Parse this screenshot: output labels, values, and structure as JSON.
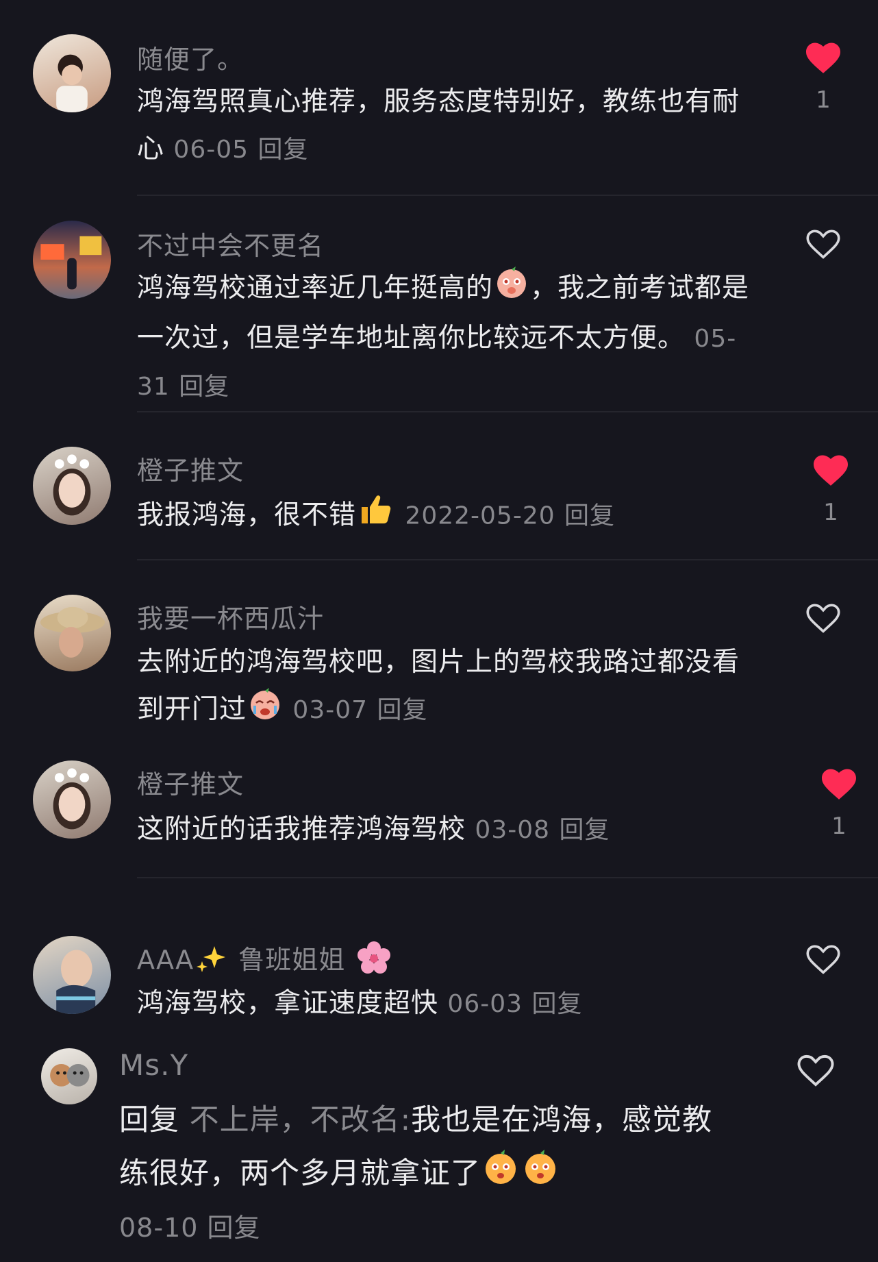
{
  "comments": [
    {
      "username": "随便了。",
      "text": "鸿海驾照真心推荐，服务态度特别好，教练也有耐心",
      "date": "06-05",
      "reply": "回复",
      "liked": true,
      "likes": "1"
    },
    {
      "username": "不过中会不更名",
      "text_a": "鸿海驾校通过率近几年挺高的",
      "text_b": "，我之前考试都是一次过，但是学车地址离你比较远不太方便。",
      "date": "05-31",
      "reply": "回复",
      "liked": false
    },
    {
      "username": "橙子推文",
      "text": "我报鸿海，很不错",
      "date": "2022-05-20",
      "reply": "回复",
      "liked": true,
      "likes": "1"
    },
    {
      "username": "我要一杯西瓜汁",
      "text": "去附近的鸿海驾校吧，图片上的驾校我路过都没看到开门过",
      "date": "03-07",
      "reply": "回复",
      "liked": false
    },
    {
      "username": "橙子推文",
      "text": "这附近的话我推荐鸿海驾校",
      "date": "03-08",
      "reply": "回复",
      "liked": true,
      "likes": "1"
    },
    {
      "username_a": "AAA",
      "username_b": "鲁班姐姐",
      "text": "鸿海驾校，拿证速度超快",
      "date": "06-03",
      "reply": "回复",
      "liked": false
    },
    {
      "username": "Ms.Y",
      "reply_prefix": "回复",
      "reply_to": "不上岸，不改名:",
      "text": "我也是在鸿海，感觉教练很好，两个多月就拿证了",
      "date": "08-10",
      "reply": "回复",
      "liked": false
    }
  ],
  "icons": {
    "heart_filled": "heart-filled-icon",
    "heart_outline": "heart-outline-icon"
  },
  "colors": {
    "background": "#16161e",
    "like_red": "#fe2c55"
  }
}
